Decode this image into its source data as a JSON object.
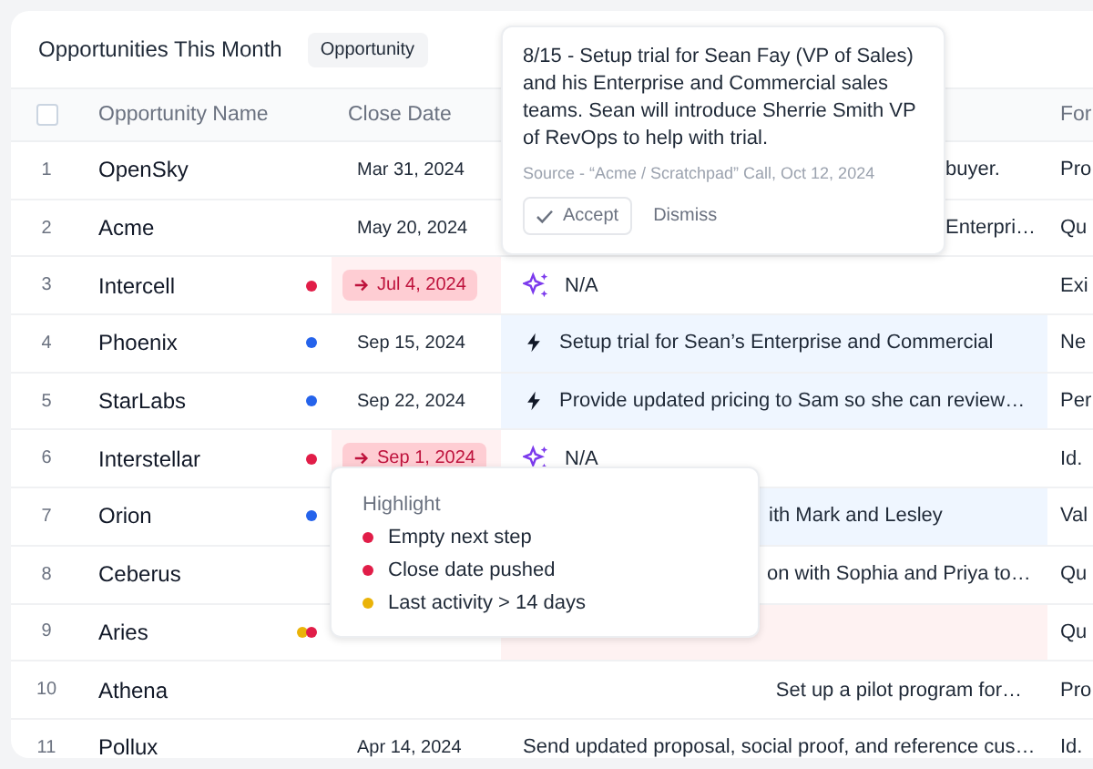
{
  "title": "Opportunities This Month",
  "tag": "Opportunity",
  "columns": [
    {
      "kind": "checkbox",
      "checked": false
    },
    {
      "kind": "text",
      "label": "Opportunity Name"
    },
    {
      "kind": "blank"
    },
    {
      "kind": "text",
      "label": "Close Date"
    },
    {
      "kind": "blank"
    },
    {
      "kind": "text",
      "label": "For"
    }
  ],
  "rows": [
    {
      "index": "1",
      "name": "OpenSky",
      "dots": [],
      "close_date": {
        "kind": "plain",
        "text": "Mar 31, 2024"
      },
      "next_step": {
        "kind": "plain",
        "text": "buyer."
      },
      "last": "Pro"
    },
    {
      "index": "2",
      "name": "Acme",
      "dots": [],
      "close_date": {
        "kind": "plain",
        "text": "May 20, 2024"
      },
      "next_step": {
        "kind": "plain",
        "text": "Enterpri…"
      },
      "last": "Qu"
    },
    {
      "index": "3",
      "name": "Intercell",
      "dots": [
        {
          "color": "#e11d48"
        }
      ],
      "close_date": {
        "kind": "pushed",
        "text": "Jul 4, 2024"
      },
      "next_step": {
        "kind": "suggested",
        "text": "N/A"
      },
      "last": "Exi"
    },
    {
      "index": "4",
      "name": "Phoenix",
      "dots": [
        {
          "color": "#2563eb"
        }
      ],
      "close_date": {
        "kind": "plain",
        "text": "Sep 15, 2024"
      },
      "next_step": {
        "kind": "action",
        "text": "Setup trial for Sean’s Enterprise and Commercial"
      },
      "last": "Ne"
    },
    {
      "index": "5",
      "name": "StarLabs",
      "dots": [
        {
          "color": "#2563eb"
        }
      ],
      "close_date": {
        "kind": "plain",
        "text": "Sep 22, 2024"
      },
      "next_step": {
        "kind": "action",
        "text": "Provide updated pricing to Sam so she can review…"
      },
      "last": "Per"
    },
    {
      "index": "6",
      "name": "Interstellar",
      "dots": [
        {
          "color": "#e11d48"
        }
      ],
      "close_date": {
        "kind": "pushed",
        "text": "Sep 1, 2024"
      },
      "next_step": {
        "kind": "suggested",
        "text": "N/A"
      },
      "last": "Id."
    },
    {
      "index": "7",
      "name": "Orion",
      "dots": [
        {
          "color": "#2563eb"
        }
      ],
      "next_step": {
        "kind": "updated",
        "text": "ith Mark and Lesley"
      },
      "last": "Val"
    },
    {
      "index": "8",
      "name": "Ceberus",
      "dots": [],
      "next_step": {
        "kind": "plain",
        "text": "on with Sophia and Priya to…"
      },
      "last": "Qu"
    },
    {
      "index": "9",
      "name": "Aries",
      "dots": [
        {
          "color": "#eab308"
        },
        {
          "color": "#e11d48"
        }
      ],
      "next_step": {
        "kind": "flagged"
      },
      "last": "Qu"
    },
    {
      "index": "10",
      "name": "Athena",
      "dots": [],
      "next_step": {
        "kind": "plain",
        "text": "Set up a pilot program for…"
      },
      "last": "Pro"
    },
    {
      "index": "11",
      "name": "Pollux",
      "dots": [],
      "close_date": {
        "kind": "plain",
        "text": "Apr 14, 2024"
      },
      "next_step": {
        "kind": "plain",
        "text": "Send updated proposal, social proof, and reference cus…"
      },
      "last": "Id."
    }
  ],
  "suggestion": {
    "text": "8/15 - Setup trial for Sean Fay (VP of Sales) and his Enterprise and Commercial sales teams. Sean will introduce Sherrie Smith VP of RevOps to help with trial.",
    "source": "Source - “Acme / Scratchpad” Call, Oct 12, 2024",
    "accept": "Accept",
    "dismiss": "Dismiss"
  },
  "highlight": {
    "title": "Highlight",
    "items": [
      {
        "label": "Empty next step",
        "color": "#e11d48"
      },
      {
        "label": "Close date pushed",
        "color": "#e11d48"
      },
      {
        "label": "Last activity > 14 days",
        "color": "#eab308"
      }
    ]
  }
}
